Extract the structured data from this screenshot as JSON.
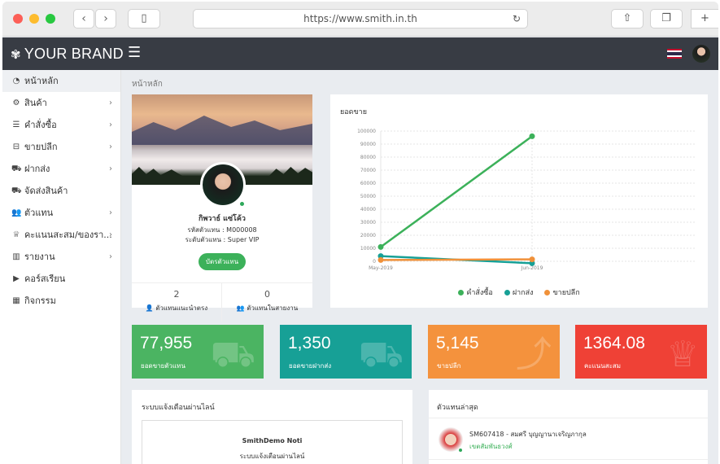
{
  "browser": {
    "url": "https://www.smith.in.th",
    "back_icon": "chevron-left-icon",
    "forward_icon": "chevron-right-icon"
  },
  "header": {
    "brand": "YOUR BRAND",
    "menu_icon": "hamburger-icon"
  },
  "sidebar": {
    "items": [
      {
        "label": "หน้าหลัก",
        "icon": "dashboard-icon",
        "chevron": false
      },
      {
        "label": "สินค้า",
        "icon": "products-icon",
        "chevron": true
      },
      {
        "label": "คำสั่งซื้อ",
        "icon": "list-icon",
        "chevron": true
      },
      {
        "label": "ขายปลีก",
        "icon": "basket-icon",
        "chevron": true
      },
      {
        "label": "ฝากส่ง",
        "icon": "cart-icon",
        "chevron": true
      },
      {
        "label": "จัดส่งสินค้า",
        "icon": "truck-icon",
        "chevron": false
      },
      {
        "label": "ตัวแทน",
        "icon": "users-icon",
        "chevron": true
      },
      {
        "label": "คะแนนสะสม/ของรา...",
        "icon": "trophy-icon",
        "chevron": true
      },
      {
        "label": "รายงาน",
        "icon": "bar-chart-icon",
        "chevron": true
      },
      {
        "label": "คอร์สเรียน",
        "icon": "play-icon",
        "chevron": false
      },
      {
        "label": "กิจกรรม",
        "icon": "calendar-icon",
        "chevron": false
      }
    ]
  },
  "breadcrumb": "หน้าหลัก",
  "profile": {
    "name": "กิพวาธ์ แซ่โค้ว",
    "code_line": "รหัสตัวแทน : M000008",
    "level_line": "ระดับตัวแทน : Super VIP",
    "card_button": "บัตรตัวแทน",
    "stats": [
      {
        "value": "2",
        "label": "ตัวแทนแนะนำตรง",
        "icon": "user-icon"
      },
      {
        "value": "0",
        "label": "ตัวแทนในสายงาน",
        "icon": "users-icon"
      }
    ]
  },
  "chart_data": {
    "type": "line",
    "title": "ยอดขาย",
    "categories": [
      "May-2019",
      "Jun-2019"
    ],
    "ylim": [
      0,
      100000
    ],
    "yticks": [
      0,
      10000,
      20000,
      30000,
      40000,
      50000,
      60000,
      70000,
      80000,
      90000,
      100000
    ],
    "grid": true,
    "legend_position": "bottom",
    "series": [
      {
        "name": "คำสั่งซื้อ",
        "color": "#3cb15a",
        "values": [
          11000,
          96000
        ]
      },
      {
        "name": "ฝากส่ง",
        "color": "#17a096",
        "values": [
          4000,
          -1500
        ]
      },
      {
        "name": "ขายปลีก",
        "color": "#f0913a",
        "values": [
          1000,
          1500
        ]
      }
    ]
  },
  "stats": [
    {
      "value": "77,955",
      "label": "ยอดขายตัวแทน",
      "color": "#4bb462",
      "icon": "cart-icon"
    },
    {
      "value": "1,350",
      "label": "ยอดขายฝากส่ง",
      "color": "#17a096",
      "icon": "truck-icon"
    },
    {
      "value": "5,145",
      "label": "ขายปลีก",
      "color": "#f4923d",
      "icon": "trend-icon"
    },
    {
      "value": "1364.08",
      "label": "คะแนนสะสม",
      "color": "#ef4136",
      "icon": "trophy-icon"
    }
  ],
  "notify": {
    "title": "ระบบแจ้งเตือนผ่านไลน์",
    "line1": "SmithDemo Noti",
    "line2": "ระบบแจ้งเตือนผ่านไลน์"
  },
  "latest": {
    "title": "ตัวแทนล่าสุด",
    "name": "SM607418 - สมศรี บุญญานาเจริญภากุล",
    "sub": "เขตสัมพันธวงศ์"
  }
}
